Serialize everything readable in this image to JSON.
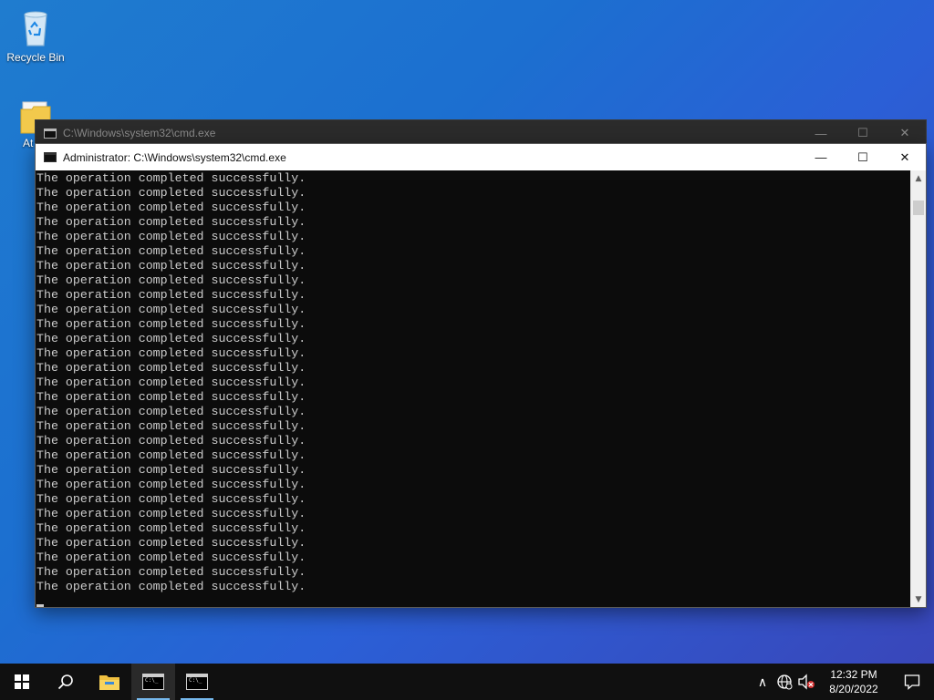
{
  "desktop": {
    "icons": [
      {
        "label": "Recycle Bin",
        "icon": "recycle-bin-icon"
      },
      {
        "label": "At",
        "icon": "folder-icon"
      }
    ]
  },
  "background_window": {
    "title": "C:\\Windows\\system32\\cmd.exe",
    "buttons": {
      "minimize": "—",
      "maximize": "☐",
      "close": "✕"
    }
  },
  "main_window": {
    "title": "Administrator: C:\\Windows\\system32\\cmd.exe",
    "buttons": {
      "minimize": "—",
      "maximize": "☐",
      "close": "✕"
    },
    "console_lines": [
      "The operation completed successfully.",
      "The operation completed successfully.",
      "The operation completed successfully.",
      "The operation completed successfully.",
      "The operation completed successfully.",
      "The operation completed successfully.",
      "The operation completed successfully.",
      "The operation completed successfully.",
      "The operation completed successfully.",
      "The operation completed successfully.",
      "The operation completed successfully.",
      "The operation completed successfully.",
      "The operation completed successfully.",
      "The operation completed successfully.",
      "The operation completed successfully.",
      "The operation completed successfully.",
      "The operation completed successfully.",
      "The operation completed successfully.",
      "The operation completed successfully.",
      "The operation completed successfully.",
      "The operation completed successfully.",
      "The operation completed successfully.",
      "The operation completed successfully.",
      "The operation completed successfully.",
      "The operation completed successfully.",
      "The operation completed successfully.",
      "The operation completed successfully.",
      "The operation completed successfully.",
      "The operation completed successfully."
    ],
    "scrollbar": {
      "up_arrow": "▲",
      "down_arrow": "▼"
    }
  },
  "taskbar": {
    "items": [
      {
        "icon": "windows-start-icon"
      },
      {
        "icon": "search-icon"
      },
      {
        "icon": "file-explorer-icon"
      },
      {
        "icon": "cmd-icon",
        "state": "active"
      },
      {
        "icon": "cmd-icon",
        "state": "running"
      }
    ],
    "tray": {
      "chevron": "∧",
      "icons": [
        "network-icon",
        "volume-muted-icon"
      ],
      "time": "12:32 PM",
      "date": "8/20/2022",
      "notification_icon": "action-center-icon"
    }
  },
  "colors": {
    "desktop_accent": "#1f7ccf",
    "console_bg": "#0c0c0c",
    "console_fg": "#cccccc",
    "taskbar_bg": "#101010",
    "taskbar_indicator": "#76b9ed"
  }
}
